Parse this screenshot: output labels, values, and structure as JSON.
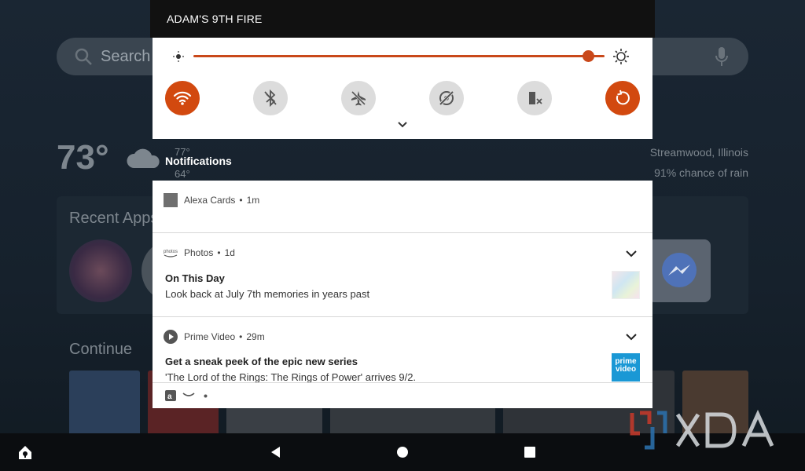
{
  "home": {
    "search_placeholder": "Search",
    "temperature": "73°",
    "high": "77°",
    "low": "64°",
    "location": "Streamwood, Illinois",
    "rain_chance": "91% chance of rain",
    "recent_apps_title": "Recent Apps",
    "continue_title": "Continue"
  },
  "status_bar": {
    "device_name": "ADAM'S 9TH FIRE"
  },
  "quick_settings": {
    "brightness_level": 0.96,
    "tiles": [
      {
        "name": "wifi",
        "state": "on"
      },
      {
        "name": "bluetooth",
        "state": "off"
      },
      {
        "name": "airplane-mode",
        "state": "off"
      },
      {
        "name": "location",
        "state": "off"
      },
      {
        "name": "do-not-disturb",
        "state": "off"
      },
      {
        "name": "auto-rotate",
        "state": "on"
      }
    ],
    "accent_color": "#d2490f"
  },
  "notifications_label": "Notifications",
  "notifications": [
    {
      "app": "Alexa Cards",
      "time": "1m"
    },
    {
      "app": "Photos",
      "time": "1d",
      "title": "On This Day",
      "text": "Look back at July 7th memories in years past"
    },
    {
      "app": "Prime Video",
      "time": "29m",
      "title": "Get a sneak peek of the epic new series",
      "text": "'The Lord of the Rings: The Rings of Power' arrives 9/2."
    }
  ],
  "separator": "•",
  "prime_thumb": {
    "line1": "prime",
    "line2": "video"
  }
}
